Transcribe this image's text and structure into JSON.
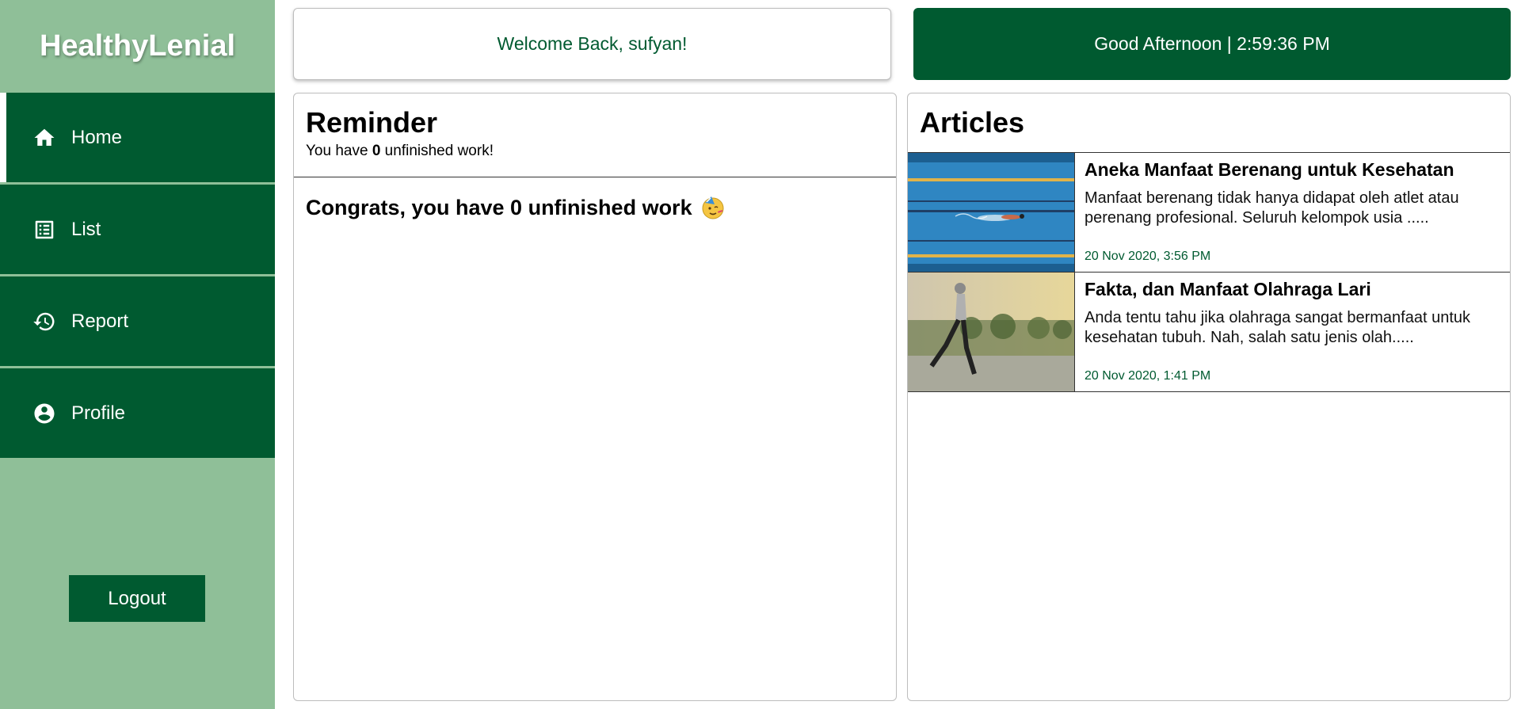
{
  "brand": "HealthyLenial",
  "nav": [
    {
      "label": "Home",
      "icon": "home-icon",
      "active": true
    },
    {
      "label": "List",
      "icon": "list-icon"
    },
    {
      "label": "Report",
      "icon": "history-icon"
    },
    {
      "label": "Profile",
      "icon": "account-circle-icon"
    }
  ],
  "logout_label": "Logout",
  "welcome": "Welcome Back, sufyan!",
  "clock": "Good Afternoon | 2:59:36 PM",
  "reminder": {
    "title": "Reminder",
    "sub_prefix": "You have ",
    "count": "0",
    "sub_suffix": " unfinished work!",
    "congrats": "Congrats, you have 0 unfinished work",
    "emoji": "partying-face-emoji"
  },
  "articles": {
    "title": "Articles",
    "items": [
      {
        "title": "Aneka Manfaat Berenang untuk Kesehatan",
        "excerpt": "Manfaat berenang tidak hanya didapat oleh atlet atau perenang profesional. Seluruh kelompok usia .....",
        "date": "20 Nov 2020, 3:56 PM",
        "image": "swimmer-photo"
      },
      {
        "title": "Fakta, dan Manfaat Olahraga Lari",
        "excerpt": "Anda tentu tahu jika olahraga sangat bermanfaat untuk kesehatan tubuh. Nah, salah satu jenis olah.....",
        "date": "20 Nov 2020, 1:41 PM",
        "image": "runner-photo"
      }
    ]
  },
  "colors": {
    "primary": "#005a30",
    "sidebar_bg": "#8fbf98",
    "accent_text": "#005a30"
  }
}
